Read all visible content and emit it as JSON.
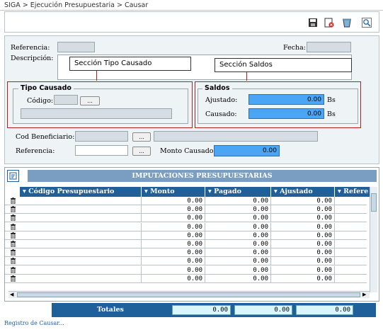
{
  "breadcrumb": "SIGA > Ejecución Presupuestaria > Causar",
  "toolbar": {
    "icons": [
      "save-icon",
      "delete-icon",
      "clear-icon",
      "search-icon"
    ]
  },
  "form": {
    "referencia_label": "Referencia:",
    "fecha_label": "Fecha:",
    "descripcion_label": "Descripción:",
    "tipo_causado_legend": "Tipo Causado",
    "codigo_label": "Código:",
    "saldos_legend": "Saldos",
    "ajustado_label": "Ajustado:",
    "ajustado_value": "0.00",
    "causado_label": "Causado:",
    "causado_value": "0.00",
    "currency": "Bs",
    "cod_beneficiario_label": "Cod Beneficiario:",
    "referencia2_label": "Referencia:",
    "monto_causado_label": "Monto Causado:",
    "monto_causado_value": "0.00",
    "dots": "..."
  },
  "annotations": {
    "tipo_causado": "Sección Tipo Causado",
    "saldos": "Sección Saldos"
  },
  "grid": {
    "title": "IMPUTACIONES PRESUPUESTARIAS",
    "columns": [
      "Código Presupuestario",
      "Monto",
      "Pagado",
      "Ajustado",
      "Refere"
    ],
    "rows": [
      [
        "",
        "0.00",
        "0.00",
        "0.00"
      ],
      [
        "",
        "0.00",
        "0.00",
        "0.00"
      ],
      [
        "",
        "0.00",
        "0.00",
        "0.00"
      ],
      [
        "",
        "0.00",
        "0.00",
        "0.00"
      ],
      [
        "",
        "0.00",
        "0.00",
        "0.00"
      ],
      [
        "",
        "0.00",
        "0.00",
        "0.00"
      ],
      [
        "",
        "0.00",
        "0.00",
        "0.00"
      ],
      [
        "",
        "0.00",
        "0.00",
        "0.00"
      ],
      [
        "",
        "0.00",
        "0.00",
        "0.00"
      ],
      [
        "",
        "0.00",
        "0.00",
        "0.00"
      ]
    ]
  },
  "totals": {
    "label": "Totales",
    "monto": "0.00",
    "pagado": "0.00",
    "ajustado": "0.00"
  },
  "status": "Registro de Causar..."
}
